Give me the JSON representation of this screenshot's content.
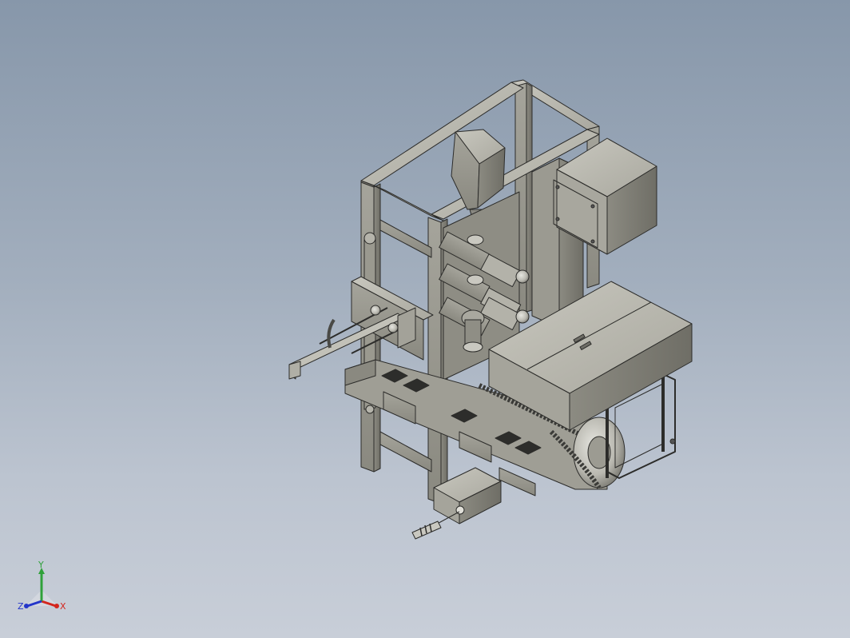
{
  "viewport": {
    "model_name": "",
    "colors": {
      "background_top": "#8797aa",
      "background_bottom": "#c8ced8",
      "part_light": "#bdbcb3",
      "part_mid": "#9e9d93",
      "part_dark": "#6f6e66",
      "edge": "#2c2c2a"
    }
  },
  "triad": {
    "x_label": "X",
    "y_label": "Y",
    "z_label": "Z",
    "x_color": "#d3261e",
    "y_color": "#2fa13a",
    "z_color": "#2436c9"
  }
}
